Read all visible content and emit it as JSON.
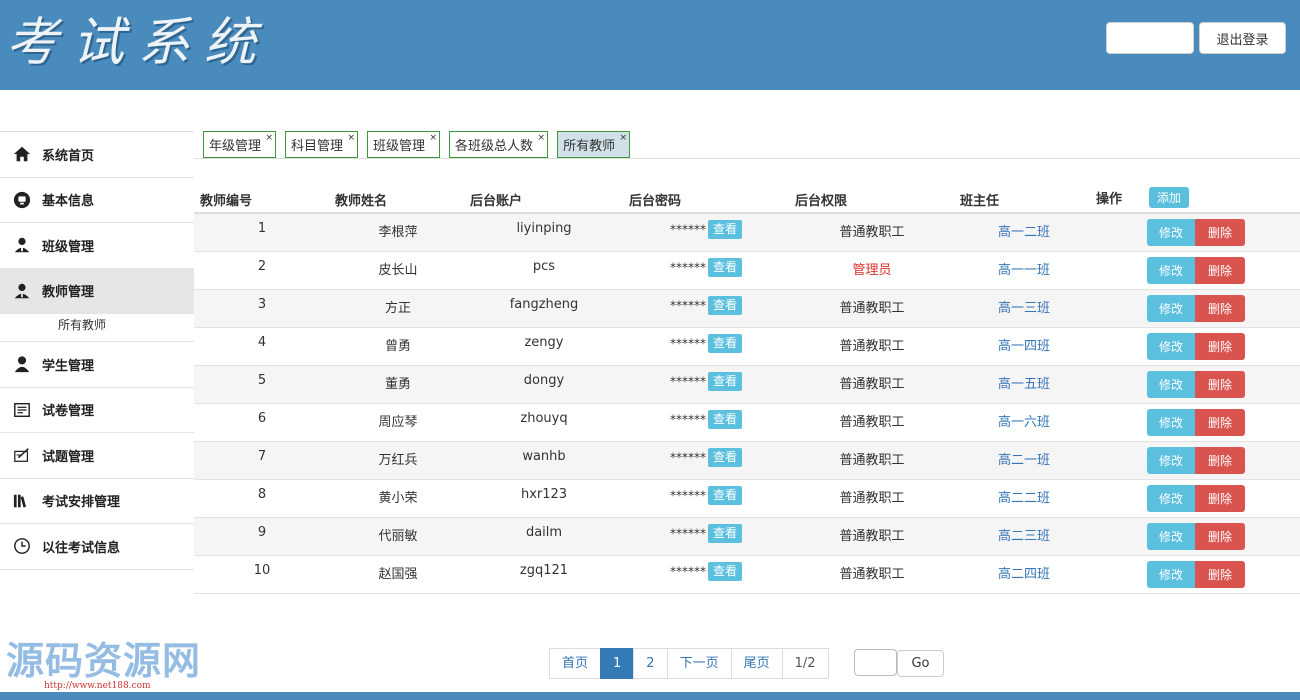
{
  "header": {
    "logo": "考试系统",
    "logout_label": "退出登录"
  },
  "sidebar": {
    "items": [
      {
        "label": "系统首页",
        "icon": "home-icon"
      },
      {
        "label": "基本信息",
        "icon": "info-icon"
      },
      {
        "label": "班级管理",
        "icon": "users-icon"
      },
      {
        "label": "教师管理",
        "icon": "users-icon"
      },
      {
        "label": "学生管理",
        "icon": "user-icon"
      },
      {
        "label": "试卷管理",
        "icon": "paper-icon"
      },
      {
        "label": "试题管理",
        "icon": "question-icon"
      },
      {
        "label": "考试安排管理",
        "icon": "books-icon"
      },
      {
        "label": "以往考试信息",
        "icon": "clock-icon"
      }
    ],
    "sub_item": "所有教师"
  },
  "tabs": [
    {
      "label": "年级管理",
      "close": "×"
    },
    {
      "label": "科目管理",
      "close": "×"
    },
    {
      "label": "班级管理",
      "close": "×"
    },
    {
      "label": "各班级总人数",
      "close": "×"
    },
    {
      "label": "所有教师",
      "close": "×"
    }
  ],
  "table": {
    "headers": {
      "id": "教师编号",
      "name": "教师姓名",
      "account": "后台账户",
      "password": "后台密码",
      "role": "后台权限",
      "class": "班主任",
      "ops": "操作",
      "add": "添加"
    },
    "pwd_mask": "******",
    "view_label": "查看",
    "edit_label": "修改",
    "delete_label": "删除",
    "rows": [
      {
        "id": "1",
        "name": "李根萍",
        "account": "liyinping",
        "role": "普通教职工",
        "class": "高一二班"
      },
      {
        "id": "2",
        "name": "皮长山",
        "account": "pcs",
        "role": "管理员",
        "class": "高一一班"
      },
      {
        "id": "3",
        "name": "方正",
        "account": "fangzheng",
        "role": "普通教职工",
        "class": "高一三班"
      },
      {
        "id": "4",
        "name": "曾勇",
        "account": "zengy",
        "role": "普通教职工",
        "class": "高一四班"
      },
      {
        "id": "5",
        "name": "董勇",
        "account": "dongy",
        "role": "普通教职工",
        "class": "高一五班"
      },
      {
        "id": "6",
        "name": "周应琴",
        "account": "zhouyq",
        "role": "普通教职工",
        "class": "高一六班"
      },
      {
        "id": "7",
        "name": "万红兵",
        "account": "wanhb",
        "role": "普通教职工",
        "class": "高二一班"
      },
      {
        "id": "8",
        "name": "黄小荣",
        "account": "hxr123",
        "role": "普通教职工",
        "class": "高二二班"
      },
      {
        "id": "9",
        "name": "代丽敏",
        "account": "dailm",
        "role": "普通教职工",
        "class": "高二三班"
      },
      {
        "id": "10",
        "name": "赵国强",
        "account": "zgq121",
        "role": "普通教职工",
        "class": "高二四班"
      }
    ]
  },
  "pagination": {
    "first": "首页",
    "pages": [
      "1",
      "2"
    ],
    "next": "下一页",
    "last": "尾页",
    "info": "1/2",
    "go": "Go"
  },
  "watermark": {
    "text": "源码资源网",
    "url": "http://www.net188.com"
  },
  "colors": {
    "header": "#4a8bbd",
    "info_button": "#5bc0de",
    "danger_button": "#d9534f",
    "link": "#3575b5",
    "admin_text": "#d9302c"
  }
}
